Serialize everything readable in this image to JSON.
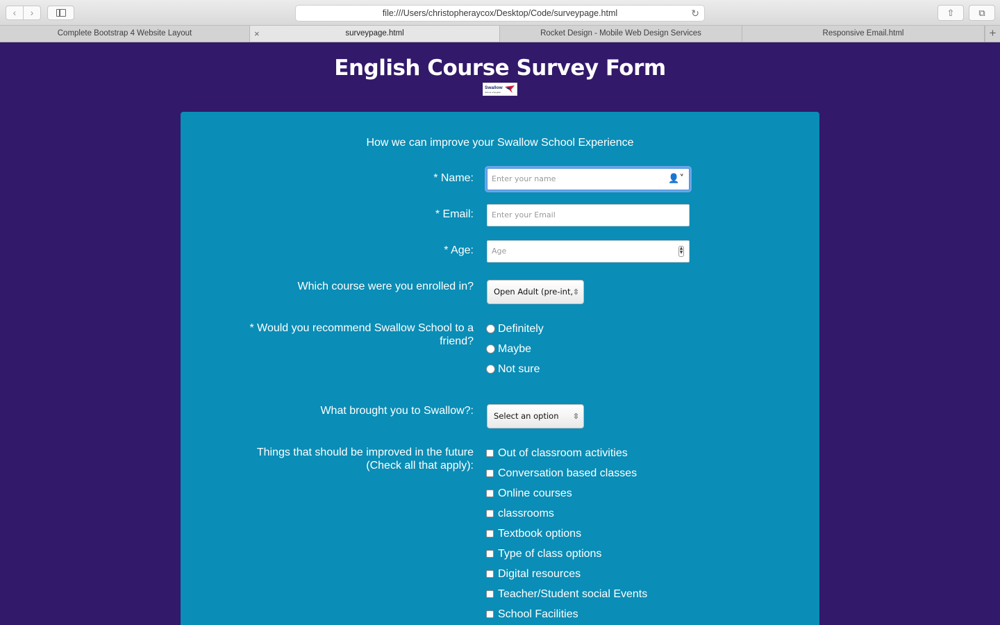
{
  "browser": {
    "url": "file:///Users/christopheraycox/Desktop/Code/surveypage.html",
    "tabs": [
      {
        "label": "Complete Bootstrap 4 Website Layout"
      },
      {
        "label": "surveypage.html"
      },
      {
        "label": "Rocket Design - Mobile Web Design Services"
      },
      {
        "label": "Responsive Email.html"
      }
    ]
  },
  "page": {
    "title": "English Course Survey Form",
    "logo_text": "Swallow",
    "logo_subtext": "School of English",
    "subtitle": "How we can improve your Swallow School Experience"
  },
  "form": {
    "name_label": "* Name:",
    "name_placeholder": "Enter your name",
    "email_label": "* Email:",
    "email_placeholder": "Enter your Email",
    "age_label": "* Age:",
    "age_placeholder": "Age",
    "course_label": "Which course were you enrolled in?",
    "course_selected": "Open Adult (pre-int,",
    "recommend_label_line1": "* Would you recommend Swallow School to a",
    "recommend_label_line2": "friend?",
    "recommend_options": [
      "Definitely",
      "Maybe",
      "Not sure"
    ],
    "brought_label": "What brought you to Swallow?:",
    "brought_selected": "Select an option",
    "improve_label_line1": "Things that should be improved in the future",
    "improve_label_line2": "(Check all that apply):",
    "improve_options": [
      "Out of classroom activities",
      "Conversation based classes",
      "Online courses",
      "classrooms",
      "Textbook options",
      "Type of class options",
      "Digital resources",
      "Teacher/Student social Events",
      "School Facilities"
    ]
  },
  "colors": {
    "background": "#32196a",
    "card": "#0a8db6",
    "focus_ring": "#6aa6e8"
  }
}
